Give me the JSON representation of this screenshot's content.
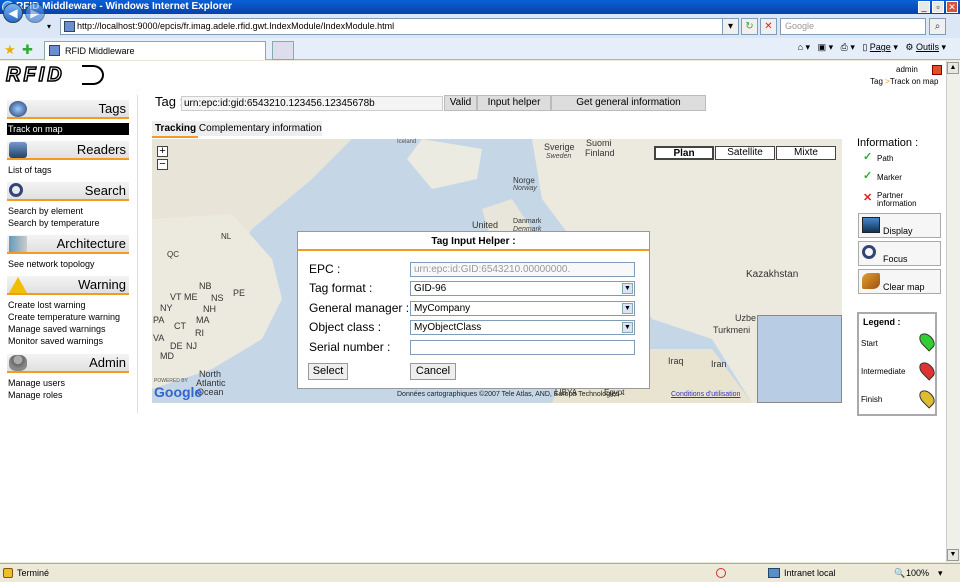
{
  "window": {
    "title": "RFID Middleware - Windows Internet Explorer"
  },
  "browser": {
    "url": "http://localhost:9000/epcis/fr.imag.adele.rfid.gwt.IndexModule/IndexModule.html",
    "search_placeholder": "Google",
    "tab_title": "RFID Middleware",
    "page_label": "Page",
    "tools_label": "Outils"
  },
  "header": {
    "logo": "RFID",
    "user": "admin",
    "breadcrumb_tag": "Tag",
    "breadcrumb_sep": ">",
    "breadcrumb_current": "Track on map"
  },
  "sidebar": {
    "tags": {
      "title": "Tags",
      "items": [
        "Track on map"
      ]
    },
    "readers": {
      "title": "Readers",
      "items": [
        "List of tags"
      ]
    },
    "search": {
      "title": "Search",
      "items": [
        "Search by element",
        "Search by temperature"
      ]
    },
    "architecture": {
      "title": "Architecture",
      "items": [
        "See network topology"
      ]
    },
    "warning": {
      "title": "Warning",
      "items": [
        "Create lost warning",
        "Create temperature warning",
        "Manage saved warnings",
        "Monitor saved warnings"
      ]
    },
    "admin": {
      "title": "Admin",
      "items": [
        "Manage users",
        "Manage roles"
      ]
    }
  },
  "tagbar": {
    "label": "Tag :",
    "value": "urn:epc:id:gid:6543210.123456.12345678b",
    "valid": "Valid",
    "helper": "Input helper",
    "general": "Get general information"
  },
  "subtabs": {
    "tracking": "Tracking",
    "complementary": "Complementary information"
  },
  "map": {
    "types": [
      "Plan",
      "Satellite",
      "Mixte"
    ],
    "labels": [
      "Iceland",
      "Sverige",
      "Suomi",
      "Sweden",
      "Finland",
      "Norge",
      "Norway",
      "United",
      "Danmark",
      "Denmark",
      "Kazakhstan",
      "NL",
      "QC",
      "NB",
      "PE",
      "VT",
      "ME",
      "NS",
      "NH",
      "NY",
      "MA",
      "CT",
      "RI",
      "PA",
      "DE",
      "NJ",
      "MD",
      "VA",
      "North",
      "Atlantic",
      "Ocean",
      "Turkmeni",
      "Uzbe",
      "Iraq",
      "Iran",
      "LIBYA",
      "Egypt"
    ],
    "copyright": "Données cartographiques ©2007 Tele Atlas, AND, Europa Technologies -",
    "terms": "Conditions d'utilisation",
    "powered": "POWERED BY",
    "google": "Google"
  },
  "modal": {
    "title": "Tag Input Helper :",
    "epc_label": "EPC :",
    "epc_value": "urn:epc:id:GID:6543210.00000000.",
    "format_label": "Tag format :",
    "format_value": "GID-96",
    "manager_label": "General manager :",
    "manager_value": "MyCompany",
    "class_label": "Object class :",
    "class_value": "MyObjectClass",
    "serial_label": "Serial number :",
    "serial_value": "",
    "select": "Select",
    "cancel": "Cancel"
  },
  "info": {
    "title": "Information :",
    "path": "Path",
    "marker": "Marker",
    "partner": "Partner information",
    "display": "Display",
    "focus": "Focus",
    "clear": "Clear map"
  },
  "legend": {
    "title": "Legend :",
    "start": "Start",
    "intermediate": "Intermediate",
    "finish": "Finish"
  },
  "status": {
    "text": "Terminé",
    "zone": "Intranet local",
    "zoom": "100%"
  },
  "colors": {
    "accent": "#f39a20",
    "ie_blue": "#0a5fd8"
  }
}
